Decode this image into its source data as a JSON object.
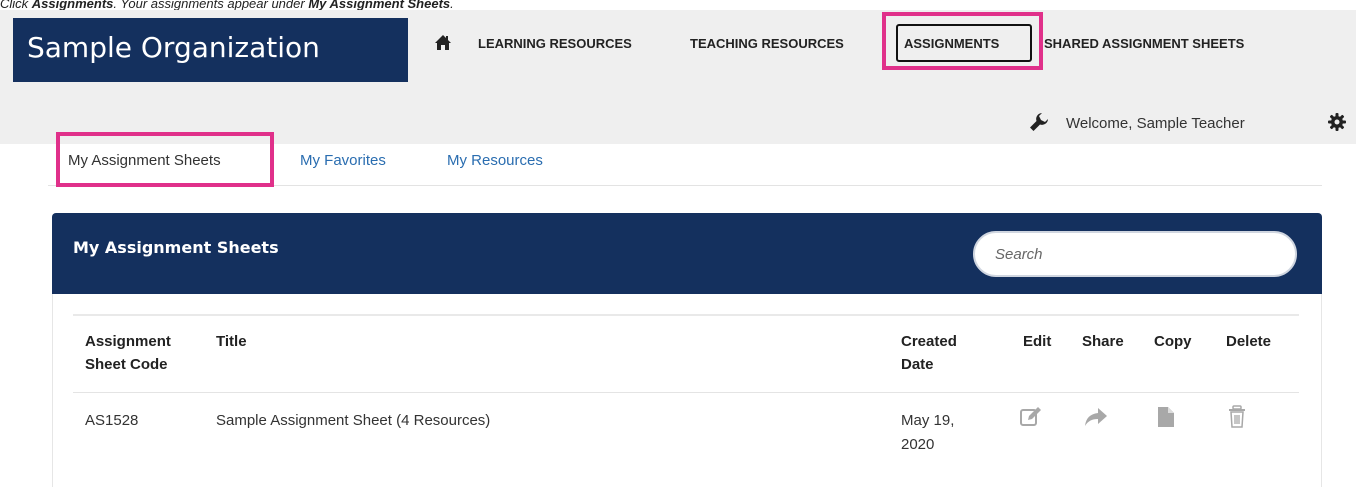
{
  "caption": {
    "prefix": "Click ",
    "target": "Assignments",
    "middle": ". Your assignments appear under ",
    "destination": "My Assignment Sheets",
    "suffix": "."
  },
  "header": {
    "org_name": "Sample Organization",
    "nav": [
      {
        "label": "LEARNING RESOURCES"
      },
      {
        "label": "TEACHING RESOURCES"
      },
      {
        "label": "ASSIGNMENTS"
      },
      {
        "label": "SHARED ASSIGNMENT SHEETS"
      }
    ],
    "welcome": "Welcome, Sample Teacher"
  },
  "tabs": [
    {
      "label": "My Assignment Sheets",
      "active": true
    },
    {
      "label": "My Favorites"
    },
    {
      "label": "My Resources"
    }
  ],
  "panel": {
    "title": "My Assignment Sheets",
    "search_placeholder": "Search"
  },
  "table": {
    "columns": {
      "code_line1": "Assignment",
      "code_line2": "Sheet Code",
      "title": "Title",
      "date_line1": "Created",
      "date_line2": "Date",
      "edit": "Edit",
      "share": "Share",
      "copy": "Copy",
      "delete": "Delete"
    },
    "rows": [
      {
        "code": "AS1528",
        "title": "Sample Assignment Sheet (4 Resources)",
        "date_line1": "May 19,",
        "date_line2": "2020"
      }
    ]
  },
  "colors": {
    "brand_navy": "#14305e",
    "highlight_pink": "#e0308a",
    "link_blue": "#2a6db0"
  },
  "icons": {
    "home": "home-icon",
    "wrench": "wrench-icon",
    "gear": "gear-icon",
    "edit": "edit-icon",
    "share": "share-icon",
    "copy": "copy-icon",
    "delete": "trash-icon"
  }
}
